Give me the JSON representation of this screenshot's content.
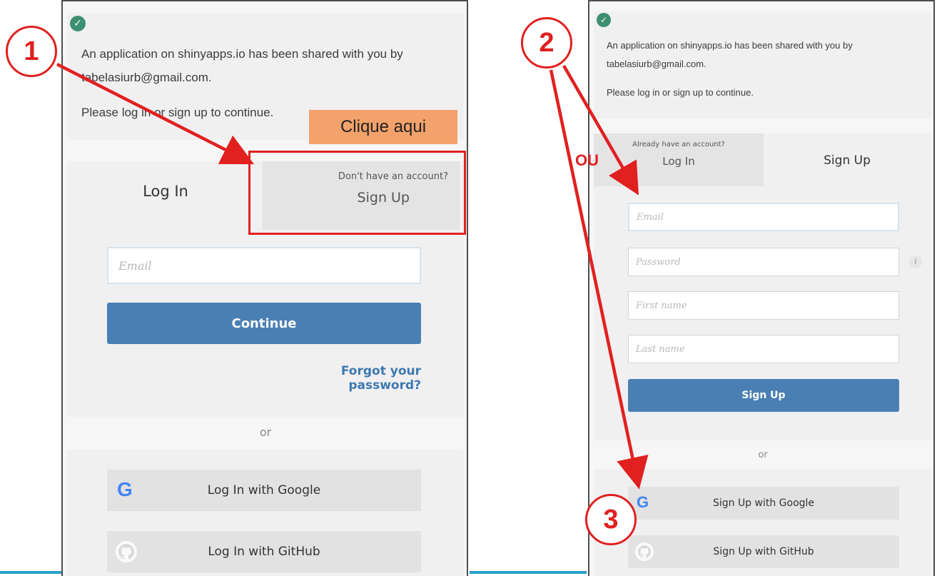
{
  "left": {
    "notice_line1": "An application on shinyapps.io has been shared with you by",
    "notice_line2": "tabelasiurb@gmail.com.",
    "notice_line3": "Please log in or sign up to continue.",
    "tab_login": "Log In",
    "tab_signup_hint": "Don't have an account?",
    "tab_signup": "Sign Up",
    "email_placeholder": "Email",
    "continue_label": "Continue",
    "forgot_label": "Forgot your password?",
    "or_label": "or",
    "google_label": "Log In with Google",
    "github_label": "Log In with GitHub"
  },
  "right": {
    "notice_line1": "An application on shinyapps.io has been shared with you by",
    "notice_line2": "tabelasiurb@gmail.com.",
    "notice_line3": "Please log in or sign up to continue.",
    "tab_login_hint": "Already have an account?",
    "tab_login": "Log In",
    "tab_signup": "Sign Up",
    "email_placeholder": "Email",
    "password_placeholder": "Password",
    "firstname_placeholder": "First name",
    "lastname_placeholder": "Last name",
    "signup_label": "Sign Up",
    "or_label": "or",
    "google_label": "Sign Up with Google",
    "github_label": "Sign Up with GitHub"
  },
  "annotations": {
    "step1": "1",
    "step2": "2",
    "step3": "3",
    "callout": "Clique aqui",
    "ou": "OU"
  },
  "icons": {
    "check": "check-circle-icon",
    "google": "google-icon",
    "github": "github-icon",
    "info": "info-icon"
  },
  "colors": {
    "primary": "#4a7fb4",
    "annotation_red": "#e12020",
    "callout_orange": "#f4a26b",
    "success_green": "#3d8f71"
  }
}
